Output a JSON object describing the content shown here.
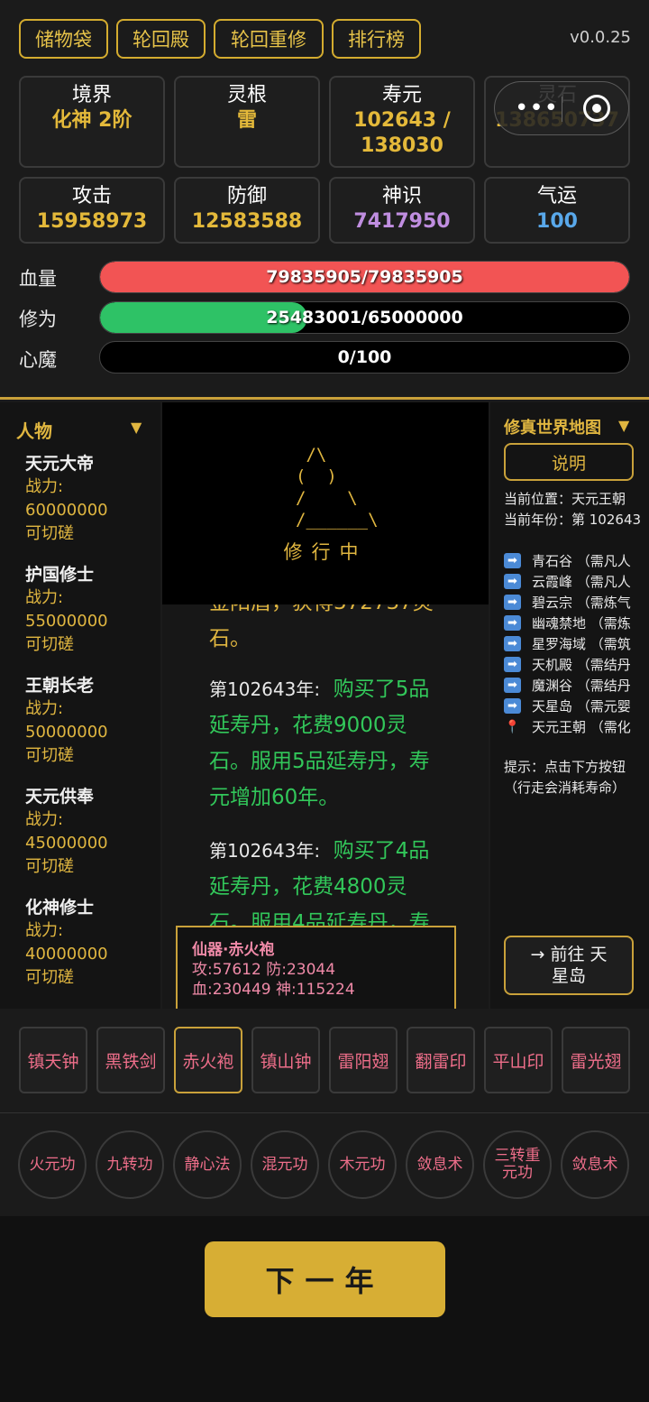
{
  "menu": [
    "储物袋",
    "轮回殿",
    "轮回重修",
    "排行榜"
  ],
  "version": "v0.0.25",
  "stats": [
    {
      "label": "境界",
      "value": "化神 2阶"
    },
    {
      "label": "灵根",
      "value": "雷"
    },
    {
      "label": "寿元",
      "value": "102643 /",
      "value2": "138030"
    },
    {
      "label": "灵石",
      "value": "138650737"
    },
    {
      "label": "攻击",
      "value": "15958973"
    },
    {
      "label": "防御",
      "value": "12583588"
    },
    {
      "label": "神识",
      "value": "7417950"
    },
    {
      "label": "气运",
      "value": "100"
    }
  ],
  "bars": {
    "hp": {
      "label": "血量",
      "text": "79835905/79835905",
      "fill": 1.0,
      "color": "#f25454"
    },
    "xiuwei": {
      "label": "修为",
      "text": "25483001/65000000",
      "fill": 0.392,
      "color": "#2ec266"
    },
    "xinmo": {
      "label": "心魔",
      "text": "0/100",
      "fill": 0.0,
      "color": "#888888"
    }
  },
  "characters_panel": {
    "title": "人物",
    "items": [
      {
        "name": "天元大帝",
        "power_label": "战力:",
        "power": "60000000",
        "status": "可切磋"
      },
      {
        "name": "护国修士",
        "power_label": "战力:",
        "power": "55000000",
        "status": "可切磋"
      },
      {
        "name": "王朝长老",
        "power_label": "战力:",
        "power": "50000000",
        "status": "可切磋"
      },
      {
        "name": "天元供奉",
        "power_label": "战力:",
        "power": "45000000",
        "status": "可切磋"
      },
      {
        "name": "化神修士",
        "power_label": "战力:",
        "power": "40000000",
        "status": "可切磋"
      }
    ]
  },
  "cultivation": {
    "ascii": " /\\\n(  )\n/    \\\n/______\\",
    "caption": "修行中"
  },
  "log": {
    "fragment_top": "金阳盾，获得372737灵",
    "fragment_top2": "石。",
    "entries": [
      {
        "year": "第102643年:",
        "msg_first": "购买了5品",
        "lines": [
          "延寿丹，花费9000灵",
          "石。服用5品延寿丹，寿",
          "元增加60年。"
        ]
      },
      {
        "year": "第102643年:",
        "msg_first": "购买了4品",
        "lines": [
          "延寿丹，花费4800灵",
          "石。服用4品延寿丹，寿"
        ]
      }
    ]
  },
  "map_panel": {
    "title": "修真世界地图",
    "explain_btn": "说明",
    "current_location": "当前位置：天元王朝",
    "current_year": "当前年份：第 102643",
    "locations": [
      {
        "text": "青石谷 （需凡人",
        "icon": "arrow"
      },
      {
        "text": "云霞峰 （需凡人",
        "icon": "arrow"
      },
      {
        "text": "碧云宗 （需炼气",
        "icon": "arrow"
      },
      {
        "text": "幽魂禁地 （需炼",
        "icon": "arrow"
      },
      {
        "text": "星罗海域 （需筑",
        "icon": "arrow"
      },
      {
        "text": "天机殿 （需结丹",
        "icon": "arrow"
      },
      {
        "text": "魔渊谷 （需结丹",
        "icon": "arrow"
      },
      {
        "text": "天星岛 （需元婴",
        "icon": "arrow"
      },
      {
        "text": "天元王朝 （需化",
        "icon": "pin"
      }
    ],
    "hint1": "提示：点击下方按钮",
    "hint2": "（行走会消耗寿命）",
    "go_btn_line1": "→ 前往 天",
    "go_btn_line2": "星岛"
  },
  "tooltip": {
    "title": "仙器·赤火袍",
    "line1": "攻:57612 防:23044",
    "line2": "血:230449 神:115224"
  },
  "equipment": [
    "镇天钟",
    "黑铁剑",
    "赤火袍",
    "镇山钟",
    "雷阳翅",
    "翻雷印",
    "平山印",
    "雷光翅"
  ],
  "equipment_selected_index": 2,
  "skills": [
    "火元功",
    "九转功",
    "静心法",
    "混元功",
    "木元功",
    "敛息术",
    "三转重元功",
    "敛息术"
  ],
  "next_button": "下一年"
}
